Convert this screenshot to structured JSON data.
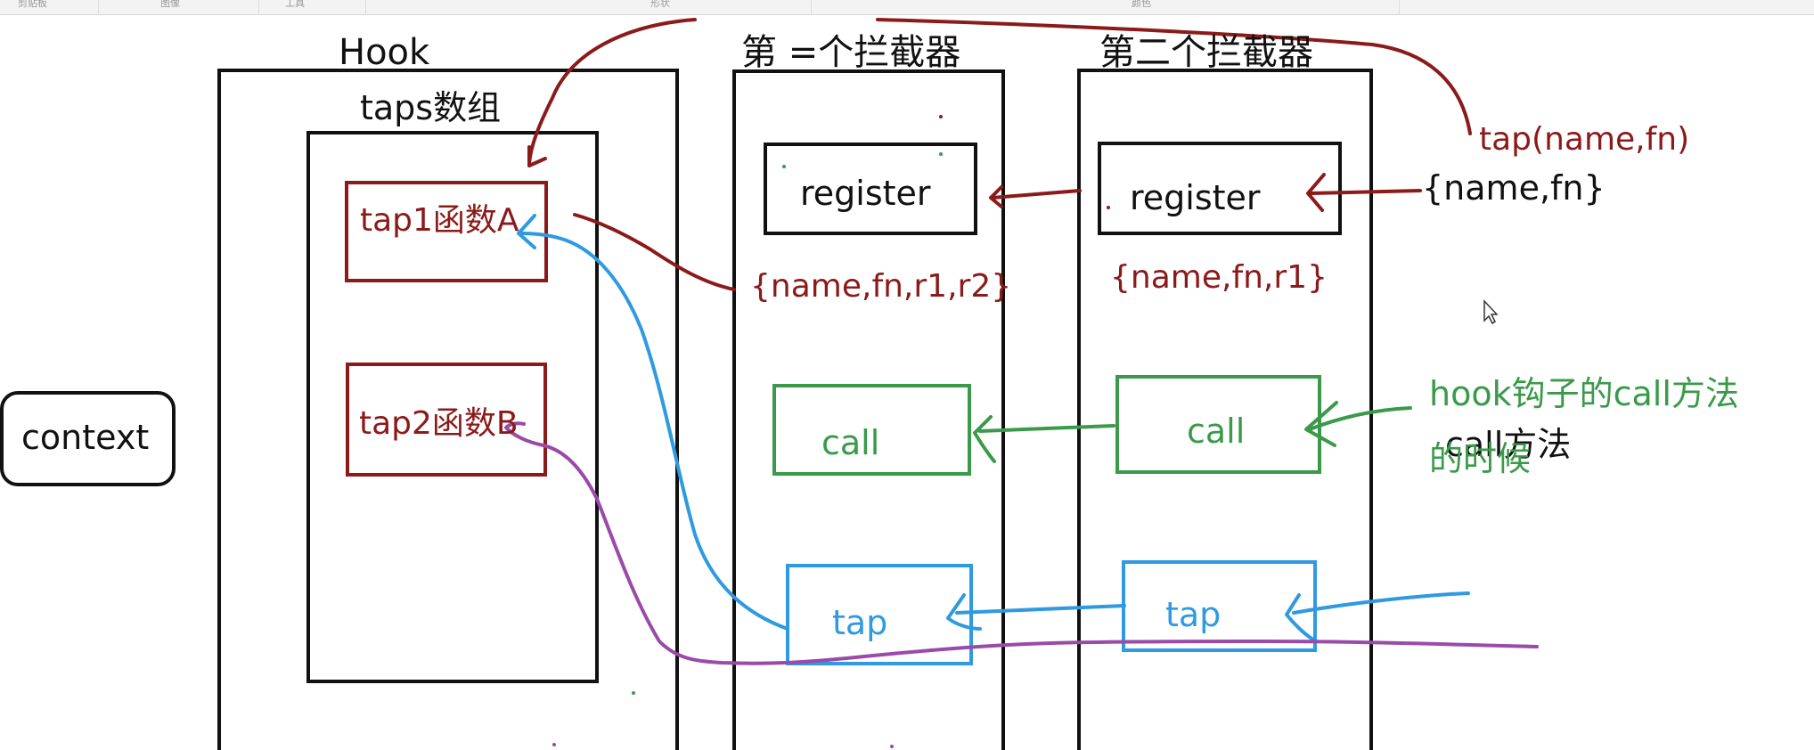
{
  "toolbar": {
    "tabs": [
      "剪贴板",
      "图像",
      "工具",
      "形状",
      "颜色"
    ]
  },
  "diagram": {
    "hook_title": "Hook",
    "taps_array_label": "taps数组",
    "tap1_label": "tap1函数A",
    "tap2_label": "tap2函数B",
    "context_label": "context",
    "interceptor2_title": "第 =个拦截器",
    "interceptor1_title": "第二个拦截器",
    "register_label": "register",
    "call_label": "call",
    "tap_label": "tap",
    "tap_signature": "tap(name,fn)",
    "name_fn": "{name,fn}",
    "name_fn_r1": "{name,fn,r1}",
    "name_fn_r1_r2": "{name,fn,r1,r2}",
    "hook_call_note_line1": "hook钩子的call方法",
    "hook_call_note_line2": "的时候",
    "call_method_note": "call方法"
  },
  "colors": {
    "black": "#111111",
    "darkred": "#8b1a1a",
    "green": "#3a9a4a",
    "blue": "#2f9ae0",
    "purple": "#9a4aa8"
  }
}
